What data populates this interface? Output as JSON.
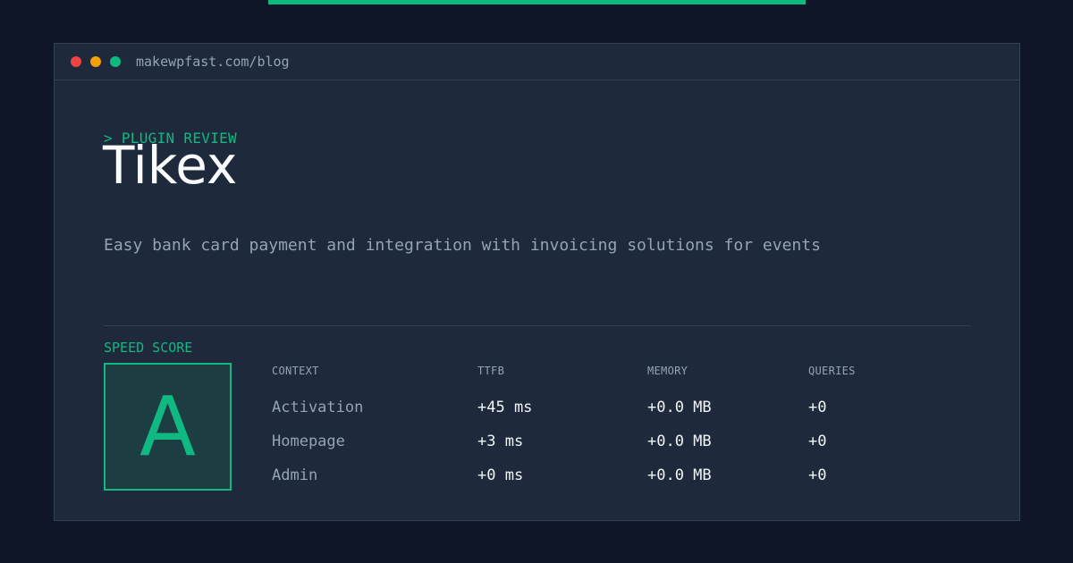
{
  "window": {
    "url": "makewpfast.com/blog"
  },
  "header": {
    "eyebrow": "> PLUGIN REVIEW",
    "title": "Tikex",
    "description": "Easy bank card payment and integration with invoicing solutions for events"
  },
  "score": {
    "label": "SPEED SCORE",
    "grade": "A"
  },
  "table": {
    "columns": [
      "CONTEXT",
      "TTFB",
      "MEMORY",
      "QUERIES"
    ],
    "rows": [
      [
        "Activation",
        "+45 ms",
        "+0.0 MB",
        "+0"
      ],
      [
        "Homepage",
        "+3 ms",
        "+0.0 MB",
        "+0"
      ],
      [
        "Admin",
        "+0 ms",
        "+0.0 MB",
        "+0"
      ]
    ]
  },
  "colors": {
    "background": "#0e1628",
    "panel": "#1e293b",
    "accent": "#10b981",
    "muted": "#94a3b8",
    "text": "#f8fafc",
    "traffic_red": "#ef4444",
    "traffic_yellow": "#f59e0b",
    "traffic_green": "#10b981"
  }
}
